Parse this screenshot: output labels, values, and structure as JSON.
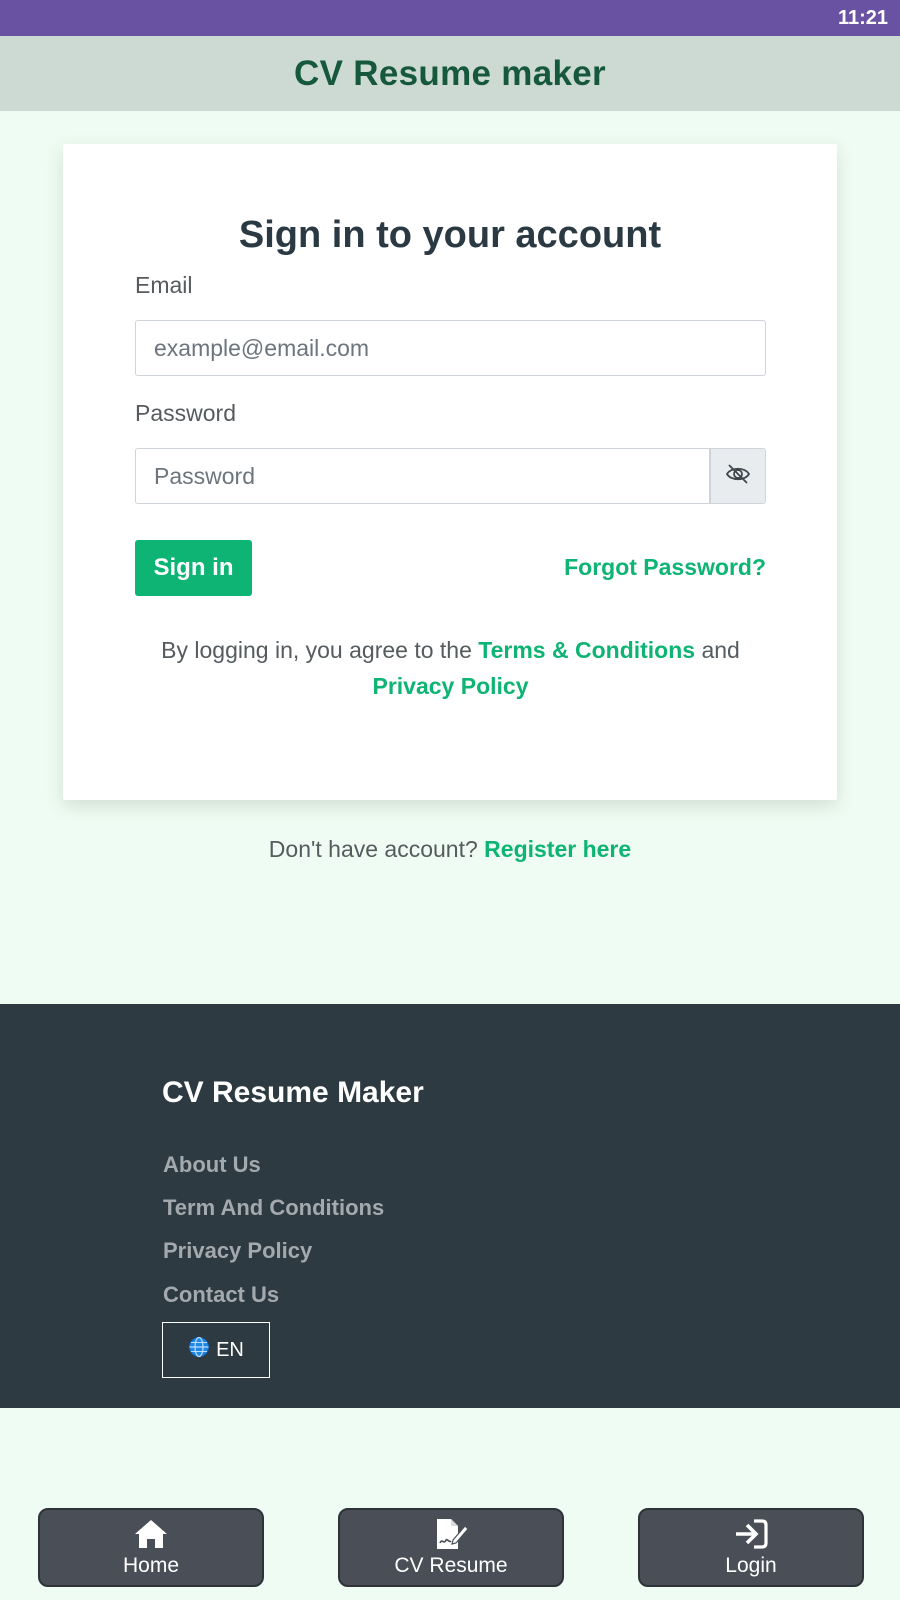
{
  "status_bar": {
    "time": "11:21"
  },
  "header": {
    "title": "CV Resume maker"
  },
  "signin_card": {
    "title": "Sign in to your account",
    "email_label": "Email",
    "email_placeholder": "example@email.com",
    "password_label": "Password",
    "password_placeholder": "Password",
    "toggle_visibility_icon": "eye-slash-icon",
    "signin_label": "Sign in",
    "forgot_label": "Forgot Password?",
    "agree_prefix": "By logging in, you agree to the",
    "terms_label": "Terms & Conditions",
    "agree_and": "and",
    "privacy_label": "Privacy Policy"
  },
  "register": {
    "prompt": "Don't have account?",
    "link_label": "Register here"
  },
  "footer": {
    "title": "CV Resume Maker",
    "links": [
      "About Us",
      "Term And Conditions",
      "Privacy Policy",
      "Contact Us"
    ],
    "language": {
      "icon": "globe-icon",
      "label": "EN"
    }
  },
  "bottom_nav": [
    {
      "icon": "home-icon",
      "label": "Home"
    },
    {
      "icon": "file-signature-icon",
      "label": "CV Resume"
    },
    {
      "icon": "sign-in-icon",
      "label": "Login"
    }
  ],
  "colors": {
    "status_bar": "#6a52a3",
    "header_bg": "#cdd9d3",
    "header_text": "#16583c",
    "page_bg": "#effcf3",
    "accent_green": "#0eb474",
    "footer_bg": "#2d3a42",
    "nav_button_bg": "#4a4f57"
  }
}
